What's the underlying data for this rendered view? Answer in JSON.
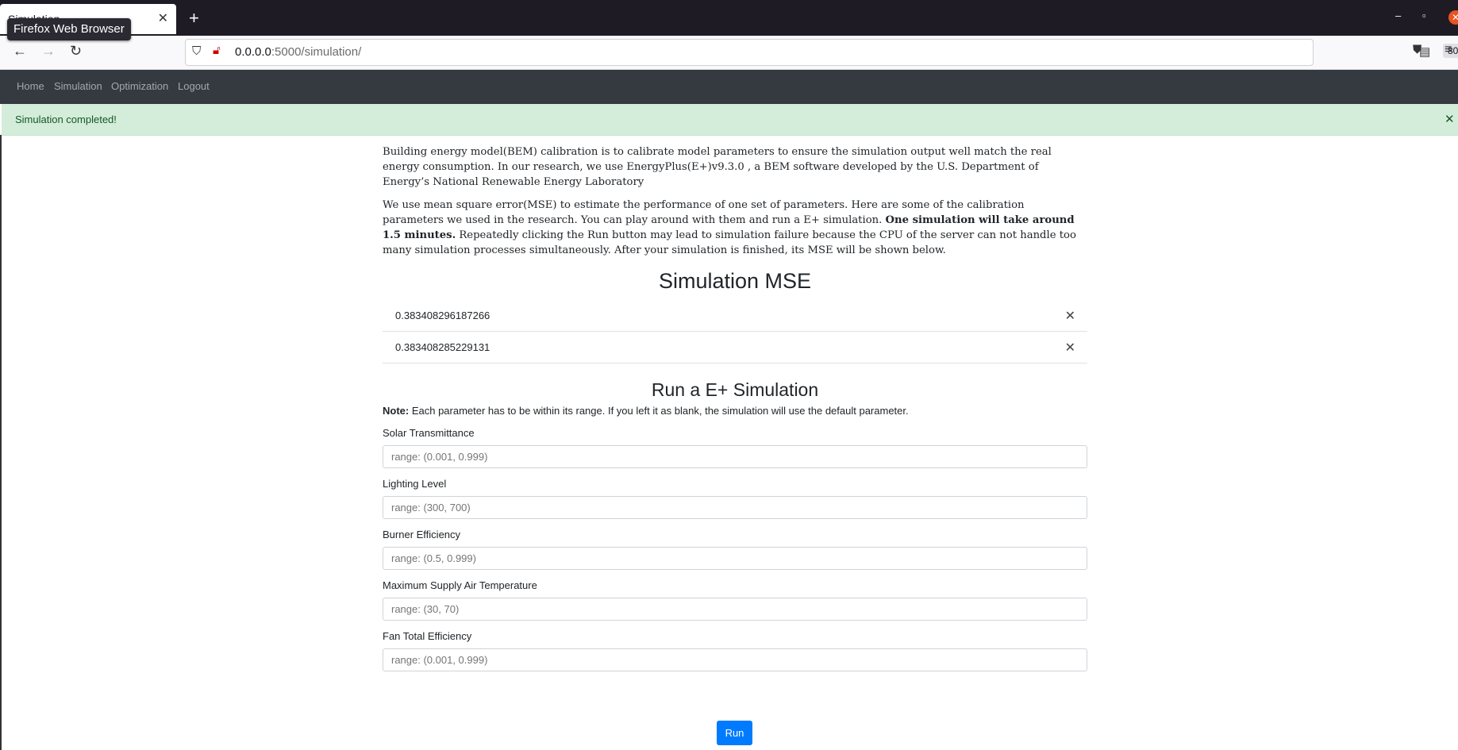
{
  "browser": {
    "tab_title": "Simulation",
    "tooltip": "Firefox Web Browser",
    "url_host": "0.0.0.0",
    "url_path": ":5000/simulation/",
    "zoom": "80%"
  },
  "nav": {
    "items": [
      "Home",
      "Simulation",
      "Optimization",
      "Logout"
    ]
  },
  "alert": {
    "message": "Simulation completed!"
  },
  "intro": {
    "p1": "Building energy model(BEM) calibration is to calibrate model parameters to ensure the simulation output well match the real energy consumption. In our research, we use EnergyPlus(E+)v9.3.0 , a BEM software developed by the U.S. Department of Energy’s National Renewable Energy Laboratory",
    "p2_a": "We use mean square error(MSE) to estimate the performance of one set of parameters. Here are some of the calibration parameters we used in the research. You can play around with them and run a E+ simulation. ",
    "p2_bold": "One simulation will take around 1.5 minutes.",
    "p2_b": " Repeatedly clicking the Run button may lead to simulation failure because the CPU of the server can not handle too many simulation processes simultaneously. After your simulation is finished, its MSE will be shown below."
  },
  "mse": {
    "title": "Simulation MSE",
    "values": [
      "0.383408296187266",
      "0.383408285229131"
    ]
  },
  "run_section": {
    "title": "Run a E+ Simulation",
    "note_label": "Note:",
    "note_text": " Each parameter has to be within its range. If you left it as blank, the simulation will use the default parameter.",
    "fields": [
      {
        "label": "Solar Transmittance",
        "placeholder": "range: (0.001, 0.999)"
      },
      {
        "label": "Lighting Level",
        "placeholder": "range: (300, 700)"
      },
      {
        "label": "Burner Efficiency",
        "placeholder": "range: (0.5, 0.999)"
      },
      {
        "label": "Maximum Supply Air Temperature",
        "placeholder": "range: (30, 70)"
      },
      {
        "label": "Fan Total Efficiency",
        "placeholder": "range: (0.001, 0.999)"
      }
    ],
    "run_label": "Run"
  },
  "colors": {
    "navbar": "#343a40",
    "alert_bg": "#d4edda",
    "alert_text": "#155724",
    "primary": "#007bff"
  }
}
